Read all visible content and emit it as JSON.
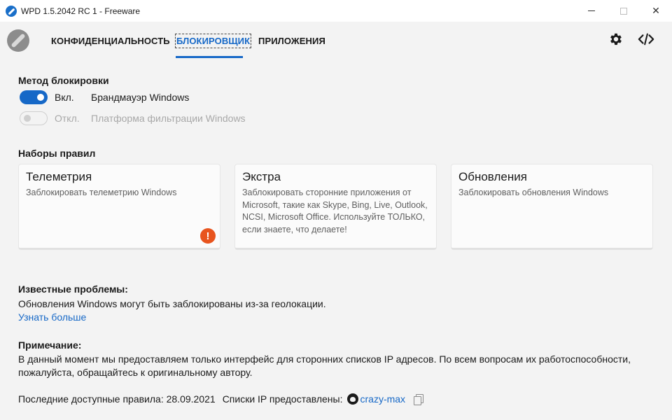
{
  "window": {
    "title": "WPD 1.5.2042 RC 1 - Freeware",
    "minimize_icon": "minimize-icon",
    "maximize_icon": "maximize-icon",
    "close_glyph": "✕"
  },
  "nav": {
    "tabs": [
      {
        "label": "КОНФИДЕНЦИАЛЬНОСТЬ",
        "active": false
      },
      {
        "label": "БЛОКИРОВЩИК",
        "active": true
      },
      {
        "label": "ПРИЛОЖЕНИЯ",
        "active": false
      }
    ],
    "icons": [
      "gear-icon",
      "code-icon"
    ],
    "accent": "#1668c7"
  },
  "blocking_method": {
    "title": "Метод блокировки",
    "options": [
      {
        "state": "Вкл.",
        "label": "Брандмауэр Windows",
        "enabled": true
      },
      {
        "state": "Откл.",
        "label": "Платформа фильтрации Windows",
        "enabled": false
      }
    ]
  },
  "rulesets": {
    "title": "Наборы правил",
    "cards": [
      {
        "title": "Телеметрия",
        "description": "Заблокировать телеметрию Windows",
        "warning": "!"
      },
      {
        "title": "Экстра",
        "description": "Заблокировать сторонние приложения от Microsoft, такие как Skype, Bing, Live, Outlook, NCSI, Microsoft Office. Используйте ТОЛЬКО, если знаете, что делаете!"
      },
      {
        "title": "Обновления",
        "description": "Заблокировать обновления Windows"
      }
    ],
    "warning_color": "#e8541e"
  },
  "known_issues": {
    "title": "Известные проблемы:",
    "text": "Обновления Windows могут быть заблокированы из-за геолокации.",
    "link": "Узнать больше"
  },
  "note": {
    "title": "Примечание:",
    "line1": "В данный момент мы предоставляем только интерфейс для сторонних списков IP адресов. По всем вопросам их работоспособности,",
    "line2": "пожалуйста, обращайтесь к оригинальному автору."
  },
  "footer": {
    "last_rules": "Последние доступные правила: 28.09.2021",
    "provided_by": "Списки IP предоставлены:",
    "author": "crazy-max"
  }
}
